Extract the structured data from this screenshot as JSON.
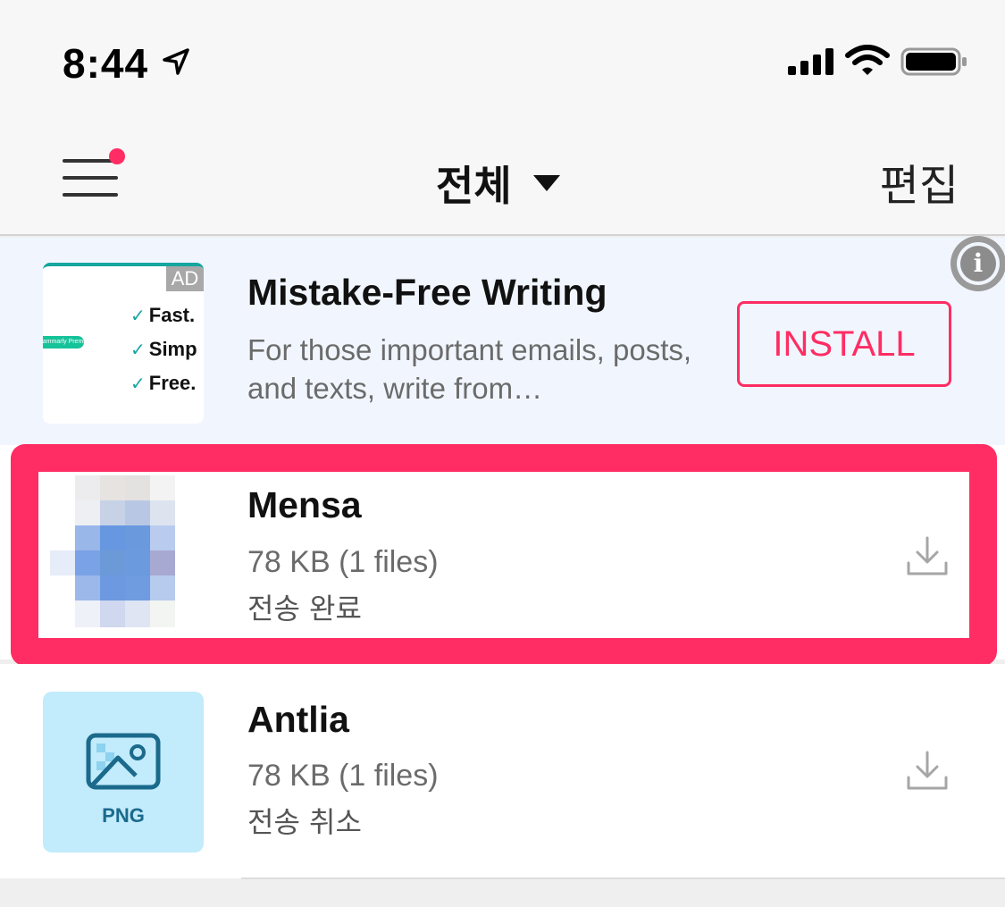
{
  "status_bar": {
    "time": "8:44",
    "icons": [
      "location-arrow-icon",
      "cellular-signal-icon",
      "wifi-icon",
      "battery-icon"
    ]
  },
  "nav": {
    "title": "전체",
    "edit_label": "편집",
    "menu_badge_color": "#ff2d63"
  },
  "ad": {
    "badge": "AD",
    "pill_text": "Grammarly Premium",
    "checks": [
      "Fast.",
      "Simp",
      "Free."
    ],
    "title": "Mistake-Free Writing",
    "description": "For those important emails, posts, and texts, write from…",
    "install_label": "INSTALL",
    "accent_color": "#ff2d63"
  },
  "files": [
    {
      "name": "Mensa",
      "size": "78 KB (1 files)",
      "status": "전송 완료",
      "highlighted": true
    },
    {
      "name": "Antlia",
      "size": "78 KB (1 files)",
      "status": "전송 취소",
      "thumb_label": "PNG"
    }
  ]
}
